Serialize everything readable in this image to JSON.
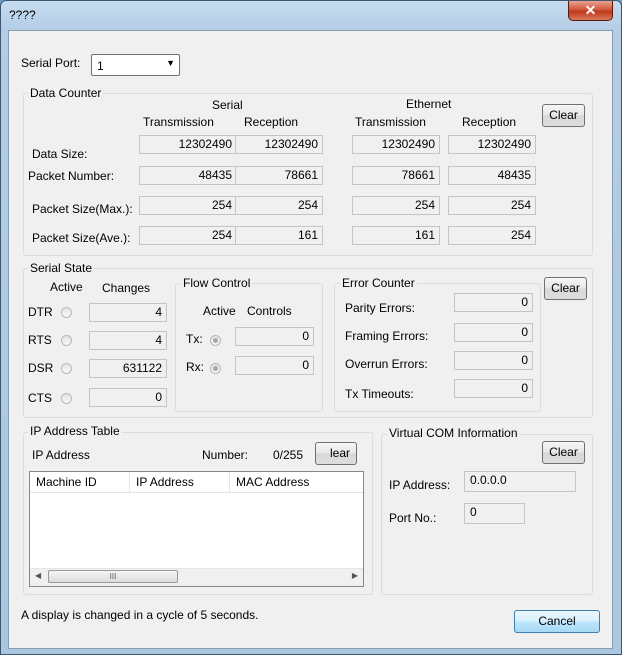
{
  "window": {
    "title": "????",
    "close_glyph": "✕"
  },
  "serial_port": {
    "label": "Serial Port:",
    "value": "1"
  },
  "data_counter": {
    "title": "Data Counter",
    "serial_header": "Serial",
    "ethernet_header": "Ethernet",
    "col_transmission": "Transmission",
    "col_reception": "Reception",
    "clear": "Clear",
    "rows": [
      {
        "label": "Data Size:",
        "values": [
          "12302490",
          "12302490",
          "12302490",
          "12302490"
        ]
      },
      {
        "label": "Packet Number:",
        "values": [
          "48435",
          "78661",
          "78661",
          "48435"
        ]
      },
      {
        "label": "Packet Size(Max.):",
        "values": [
          "254",
          "254",
          "254",
          "254"
        ]
      },
      {
        "label": "Packet Size(Ave.):",
        "values": [
          "254",
          "161",
          "161",
          "254"
        ]
      }
    ]
  },
  "serial_state": {
    "title": "Serial State",
    "col_active": "Active",
    "col_changes": "Changes",
    "rows": [
      {
        "label": "DTR",
        "changes": "4"
      },
      {
        "label": "RTS",
        "changes": "4"
      },
      {
        "label": "DSR",
        "changes": "631122"
      },
      {
        "label": "CTS",
        "changes": "0"
      }
    ]
  },
  "flow_control": {
    "title": "Flow Control",
    "col_active": "Active",
    "col_controls": "Controls",
    "rows": [
      {
        "label": "Tx:",
        "value": "0"
      },
      {
        "label": "Rx:",
        "value": "0"
      }
    ]
  },
  "error_counter": {
    "title": "Error Counter",
    "clear": "Clear",
    "rows": [
      {
        "label": "Parity Errors:",
        "value": "0"
      },
      {
        "label": "Framing Errors:",
        "value": "0"
      },
      {
        "label": "Overrun Errors:",
        "value": "0"
      },
      {
        "label": "Tx Timeouts:",
        "value": "0"
      }
    ]
  },
  "ip_table": {
    "title": "IP Address Table",
    "ip_label": "IP Address",
    "number_label": "Number:",
    "number_value": "0/255",
    "clear": "lear",
    "columns": [
      "Machine ID",
      "IP Address",
      "MAC Address"
    ],
    "scroll_grip": "III"
  },
  "virtual_com": {
    "title": "Virtual COM Information",
    "clear": "Clear",
    "ip_label": "IP Address:",
    "ip_value": "0.0.0.0",
    "port_label": "Port No.:",
    "port_value": "0"
  },
  "footer": {
    "note": "A display is changed in a cycle of 5 seconds.",
    "cancel": "Cancel"
  }
}
